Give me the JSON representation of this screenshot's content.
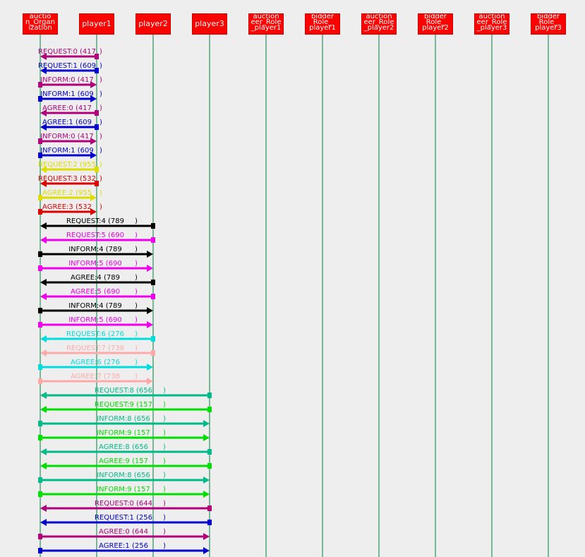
{
  "lifelines": [
    {
      "name": "auction_Organization",
      "lines": [
        "auctio",
        "n_Organ",
        "ization"
      ]
    },
    {
      "name": "player1",
      "lines": [
        "player1"
      ]
    },
    {
      "name": "player2",
      "lines": [
        "player2"
      ]
    },
    {
      "name": "player3",
      "lines": [
        "player3"
      ]
    },
    {
      "name": "auctioneer_Role_player1",
      "lines": [
        "auction",
        "eer_Role",
        "_player1"
      ]
    },
    {
      "name": "bidderRole_player1",
      "lines": [
        "bidder",
        "Role_",
        "player1"
      ]
    },
    {
      "name": "auctioneer_Role_player2",
      "lines": [
        "auction",
        "eer_Role",
        "_player2"
      ]
    },
    {
      "name": "bidderRole_player2",
      "lines": [
        "bidder",
        "Role_",
        "player2"
      ]
    },
    {
      "name": "auctioneer_Role_player3",
      "lines": [
        "auction",
        "eer_Role",
        "_player3"
      ]
    },
    {
      "name": "bidderRole_player3",
      "lines": [
        "bidder",
        "Role_",
        "player3"
      ]
    }
  ],
  "colors": {
    "lifeline_box": "#ff0000",
    "lifeline_line": "#008040",
    "background": "#eeeeee"
  },
  "messages": [
    {
      "label": "REQUEST:0 (417",
      "close": ")",
      "from": 1,
      "to": 0,
      "color": "#b0007a"
    },
    {
      "label": "REQUEST:1 (609",
      "close": ")",
      "from": 1,
      "to": 0,
      "color": "#0000cc"
    },
    {
      "label": "INFORM:0 (417",
      "close": ")",
      "from": 0,
      "to": 1,
      "color": "#b0007a"
    },
    {
      "label": "INFORM:1 (609",
      "close": ")",
      "from": 0,
      "to": 1,
      "color": "#0000cc"
    },
    {
      "label": "AGREE:0 (417",
      "close": ")",
      "from": 1,
      "to": 0,
      "color": "#b0007a"
    },
    {
      "label": "AGREE:1 (609",
      "close": ")",
      "from": 1,
      "to": 0,
      "color": "#0000cc"
    },
    {
      "label": "INFORM:0 (417",
      "close": ")",
      "from": 0,
      "to": 1,
      "color": "#b0007a"
    },
    {
      "label": "INFORM:1 (609",
      "close": ")",
      "from": 0,
      "to": 1,
      "color": "#0000cc"
    },
    {
      "label": "REQUEST:2 (955",
      "close": ")",
      "from": 1,
      "to": 0,
      "color": "#dddd00"
    },
    {
      "label": "REQUEST:3 (532",
      "close": ")",
      "from": 1,
      "to": 0,
      "color": "#dd0000"
    },
    {
      "label": "AGREE:2 (955",
      "close": ")",
      "from": 0,
      "to": 1,
      "color": "#dddd00"
    },
    {
      "label": "AGREE:3 (532",
      "close": ")",
      "from": 0,
      "to": 1,
      "color": "#dd0000"
    },
    {
      "label": "REQUEST:4 (789",
      "close": ")",
      "from": 2,
      "to": 0,
      "color": "#000000"
    },
    {
      "label": "REQUEST:5 (690",
      "close": ")",
      "from": 2,
      "to": 0,
      "color": "#ee00ee"
    },
    {
      "label": "INFORM:4 (789",
      "close": ")",
      "from": 0,
      "to": 2,
      "color": "#000000"
    },
    {
      "label": "INFORM:5 (690",
      "close": ")",
      "from": 0,
      "to": 2,
      "color": "#ee00ee"
    },
    {
      "label": "AGREE:4 (789",
      "close": ")",
      "from": 2,
      "to": 0,
      "color": "#000000"
    },
    {
      "label": "AGREE:5 (690",
      "close": ")",
      "from": 2,
      "to": 0,
      "color": "#ee00ee"
    },
    {
      "label": "INFORM:4 (789",
      "close": ")",
      "from": 0,
      "to": 2,
      "color": "#000000"
    },
    {
      "label": "INFORM:5 (690",
      "close": ")",
      "from": 0,
      "to": 2,
      "color": "#ee00ee"
    },
    {
      "label": "REQUEST:6 (276",
      "close": ")",
      "from": 2,
      "to": 0,
      "color": "#00dddd"
    },
    {
      "label": "REQUEST:7 (738",
      "close": ")",
      "from": 2,
      "to": 0,
      "color": "#ffaaaa"
    },
    {
      "label": "AGREE:6 (276",
      "close": ")",
      "from": 0,
      "to": 2,
      "color": "#00dddd"
    },
    {
      "label": "AGREE:7 (738",
      "close": ")",
      "from": 0,
      "to": 2,
      "color": "#ffaaaa"
    },
    {
      "label": "REQUEST:8 (656",
      "close": ")",
      "from": 3,
      "to": 0,
      "color": "#00bb88"
    },
    {
      "label": "REQUEST:9 (157",
      "close": ")",
      "from": 3,
      "to": 0,
      "color": "#00dd00"
    },
    {
      "label": "INFORM:8 (656",
      "close": ")",
      "from": 0,
      "to": 3,
      "color": "#00bb88"
    },
    {
      "label": "INFORM:9 (157",
      "close": ")",
      "from": 0,
      "to": 3,
      "color": "#00dd00"
    },
    {
      "label": "AGREE:8 (656",
      "close": ")",
      "from": 3,
      "to": 0,
      "color": "#00bb88"
    },
    {
      "label": "AGREE:9 (157",
      "close": ")",
      "from": 3,
      "to": 0,
      "color": "#00dd00"
    },
    {
      "label": "INFORM:8 (656",
      "close": ")",
      "from": 0,
      "to": 3,
      "color": "#00bb88"
    },
    {
      "label": "INFORM:9 (157",
      "close": ")",
      "from": 0,
      "to": 3,
      "color": "#00dd00"
    },
    {
      "label": "REQUEST:0 (644",
      "close": ")",
      "from": 3,
      "to": 0,
      "color": "#b0007a"
    },
    {
      "label": "REQUEST:1 (256",
      "close": ")",
      "from": 3,
      "to": 0,
      "color": "#0000cc"
    },
    {
      "label": "AGREE:0 (644",
      "close": ")",
      "from": 0,
      "to": 3,
      "color": "#b0007a"
    },
    {
      "label": "AGREE:1 (256",
      "close": ")",
      "from": 0,
      "to": 3,
      "color": "#0000cc"
    }
  ]
}
